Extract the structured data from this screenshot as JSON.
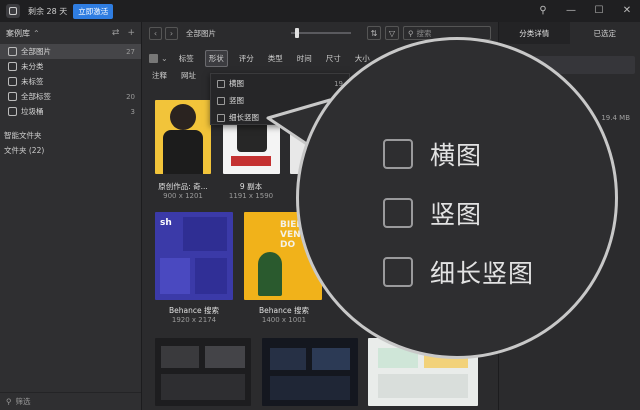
{
  "titlebar": {
    "trial_text": "剩余 28 天",
    "activate_label": "立即激活",
    "pin_icon": "pin-icon",
    "min_icon": "minimize-icon",
    "max_icon": "maximize-icon",
    "close_icon": "close-icon"
  },
  "sidebar": {
    "library_label": "案例库",
    "items": [
      {
        "label": "全部图片",
        "count": "27",
        "active": true
      },
      {
        "label": "未分类",
        "count": ""
      },
      {
        "label": "未标签",
        "count": ""
      },
      {
        "label": "全部标签",
        "count": "20"
      },
      {
        "label": "垃圾桶",
        "count": "3"
      }
    ],
    "smart_folders": "智能文件夹",
    "folders": "文件夹 (22)",
    "filter_label": "筛选"
  },
  "toolbar": {
    "breadcrumb": "全部图片",
    "search_placeholder": "搜索",
    "zoom_level": 0.08
  },
  "filters": {
    "row1": [
      "标签",
      "形状",
      "评分",
      "类型",
      "时间",
      "尺寸",
      "大小"
    ],
    "row2": [
      "注释",
      "网址"
    ],
    "active": "形状"
  },
  "dropdown": {
    "items": [
      {
        "label": "横图",
        "count": "19"
      },
      {
        "label": "竖图",
        "count": ""
      },
      {
        "label": "细长竖图",
        "count": ""
      }
    ]
  },
  "grid": [
    {
      "name": "原创作品: 奇...",
      "size": "900 x 1201"
    },
    {
      "name": "9 副本",
      "size": "1191 x 1590"
    },
    {
      "name": "Behance 搜索",
      "size": "1920 x 2174"
    },
    {
      "name": "Behance 搜索",
      "size": "1400 x 1001"
    }
  ],
  "thumb_texts": {
    "bienvenido": "BIEN VENI DO",
    "sh": "sh"
  },
  "rpanel": {
    "tabs": [
      "分类详情",
      "已选定"
    ],
    "box_text": "图片",
    "file_size": "19.4 MB"
  },
  "magnifier": {
    "items": [
      "横图",
      "竖图",
      "细长竖图"
    ]
  },
  "colors": {
    "accent": "#2f7de1",
    "bg": "#2b2b2d",
    "sidebar": "#2f2f31",
    "yellow": "#f1b21a",
    "blue_card": "#3b3aa8"
  }
}
